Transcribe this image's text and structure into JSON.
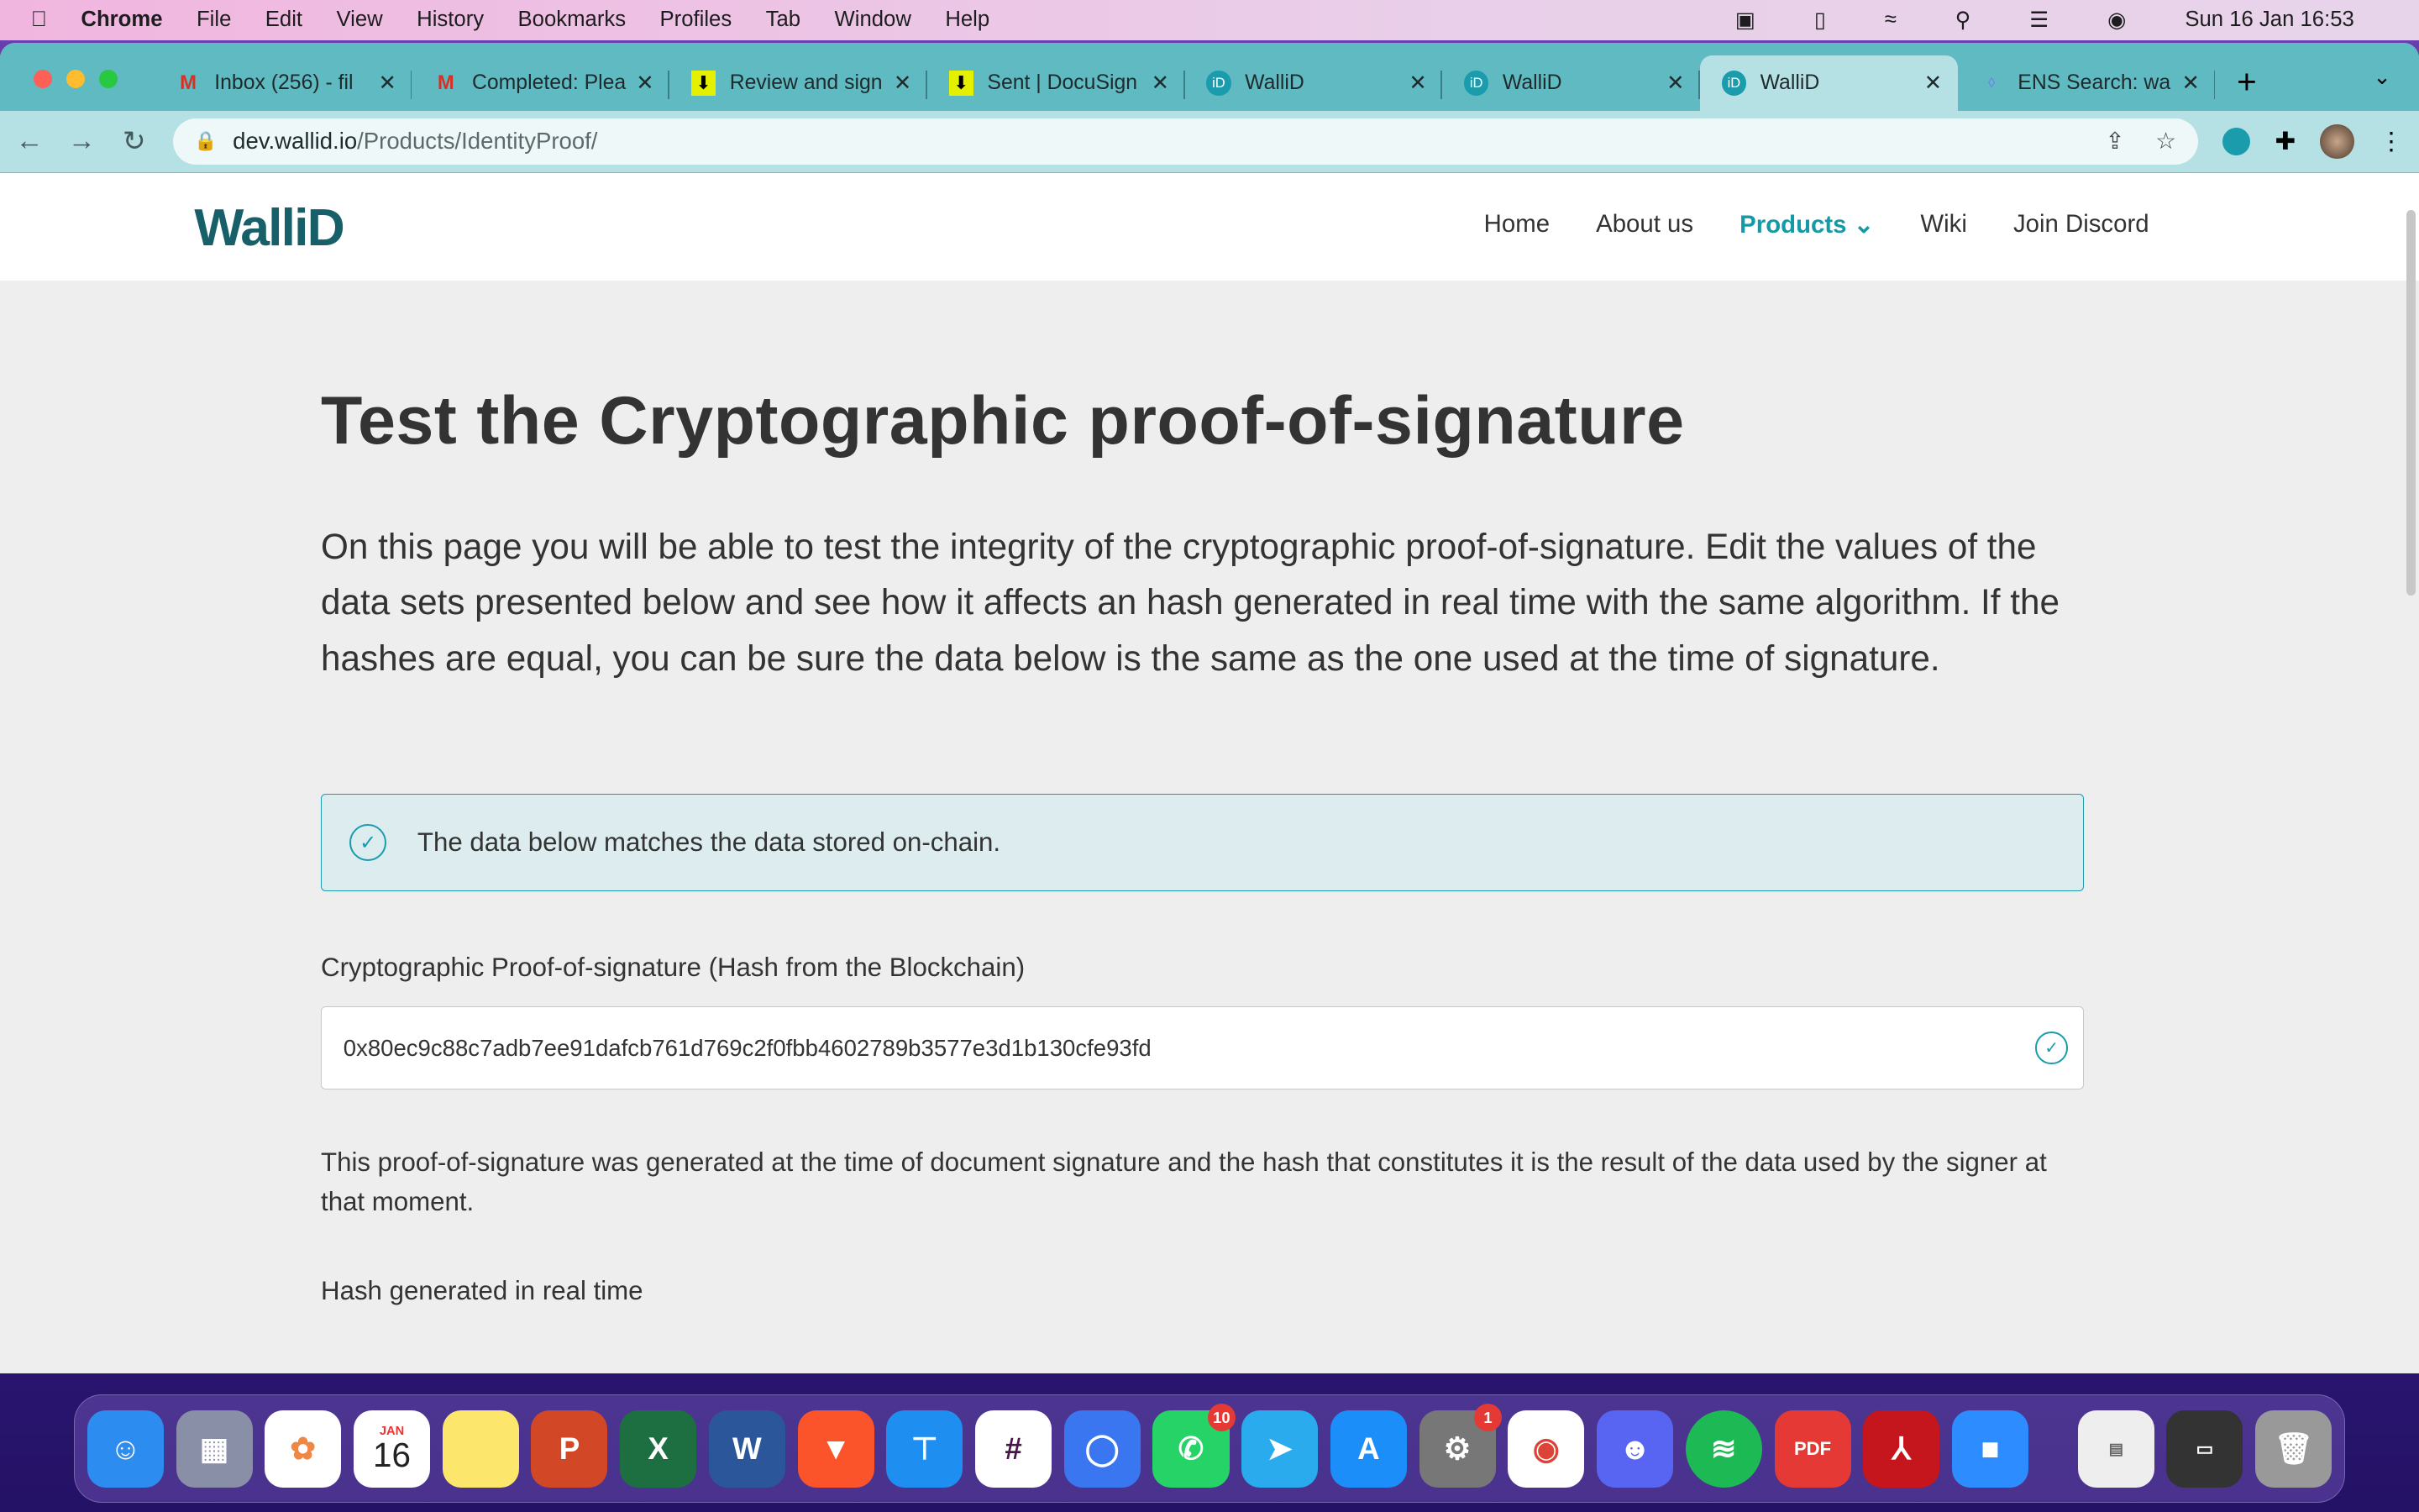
{
  "menubar": {
    "app": "Chrome",
    "items": [
      "File",
      "Edit",
      "View",
      "History",
      "Bookmarks",
      "Profiles",
      "Tab",
      "Window",
      "Help"
    ],
    "clock": "Sun 16 Jan  16:53"
  },
  "tabs": [
    {
      "title": "Inbox (256) - fil",
      "icon": "gmail-icon"
    },
    {
      "title": "Completed: Plea",
      "icon": "gmail-icon"
    },
    {
      "title": "Review and sign",
      "icon": "docusign-icon"
    },
    {
      "title": "Sent | DocuSign",
      "icon": "docusign-icon"
    },
    {
      "title": "WalliD",
      "icon": "wallid-icon"
    },
    {
      "title": "WalliD",
      "icon": "wallid-icon"
    },
    {
      "title": "WalliD",
      "icon": "wallid-icon",
      "active": true
    },
    {
      "title": "ENS Search: wa",
      "icon": "ens-icon"
    }
  ],
  "address": {
    "host": "dev.wallid.io",
    "path": "/Products/IdentityProof/"
  },
  "site": {
    "logo": "WalliD",
    "nav": [
      "Home",
      "About us",
      "Products",
      "Wiki",
      "Join Discord"
    ],
    "active_nav": "Products"
  },
  "main": {
    "title": "Test the Cryptographic proof-of-signature",
    "intro": "On this page you will be able to test the integrity of the cryptographic proof-of-signature. Edit the values of the data sets presented below and see how it affects an hash generated in real time with the same algorithm. If the hashes are equal, you can be sure the data below is the same as the one used at the time of signature.",
    "alert": "The data below matches the data stored on-chain.",
    "hash_label": "Cryptographic Proof-of-signature (Hash from the Blockchain)",
    "hash_value": "0x80ec9c88c7adb7ee91dafcb761d769c2f0fbb4602789b3577e3d1b130cfe93fd",
    "help": "This proof-of-signature was generated at the time of document signature and the hash that constitutes it is the result of the data used by the signer at that moment.",
    "realtime_label": "Hash generated in real time"
  },
  "colors": {
    "accent": "#1a9cad",
    "tabstrip": "#5fbac2"
  },
  "dock": {
    "calendar_month": "JAN",
    "calendar_day": "16",
    "whatsapp_badge": "10",
    "settings_badge": "1"
  }
}
